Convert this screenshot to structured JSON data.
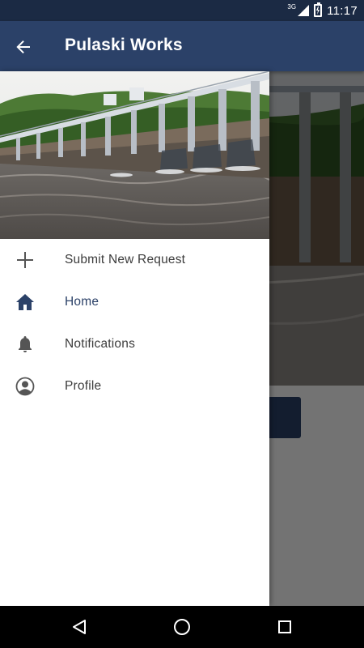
{
  "status_bar": {
    "network_type": "3G",
    "time": "11:17"
  },
  "app_bar": {
    "title": "Pulaski Works"
  },
  "drawer": {
    "header_image": "dam-bridge-photo",
    "items": [
      {
        "label": "Submit New Request",
        "icon": "plus-icon",
        "active": false
      },
      {
        "label": "Home",
        "icon": "home-icon",
        "active": true
      },
      {
        "label": "Notifications",
        "icon": "bell-icon",
        "active": false
      },
      {
        "label": "Profile",
        "icon": "profile-icon",
        "active": false
      }
    ]
  },
  "colors": {
    "primary": "#2b4168",
    "status_bar": "#1b2a44",
    "drawer_bg": "#ffffff",
    "icon_gray": "#555555",
    "active_icon": "#2b4168"
  }
}
